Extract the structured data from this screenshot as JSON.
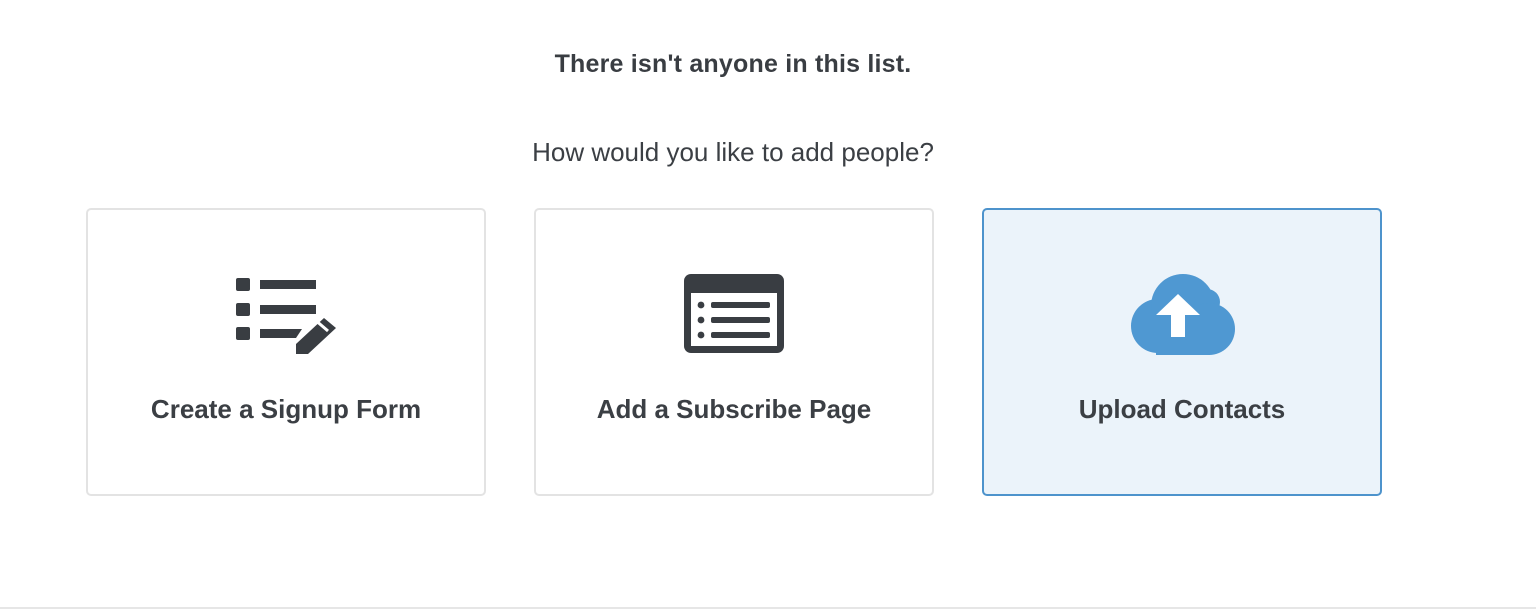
{
  "empty_state": {
    "title": "There isn't anyone in this list.",
    "prompt": "How would you like to add people?"
  },
  "options": [
    {
      "label": "Create a Signup Form",
      "icon": "signup-form-icon",
      "selected": false
    },
    {
      "label": "Add a Subscribe Page",
      "icon": "subscribe-page-icon",
      "selected": false
    },
    {
      "label": "Upload Contacts",
      "icon": "cloud-upload-icon",
      "selected": true
    }
  ],
  "colors": {
    "text": "#393d42",
    "card_border": "#e3e3e3",
    "selected_border": "#4d93cc",
    "selected_background": "#ebf3fa",
    "accent": "#4f98d2"
  }
}
